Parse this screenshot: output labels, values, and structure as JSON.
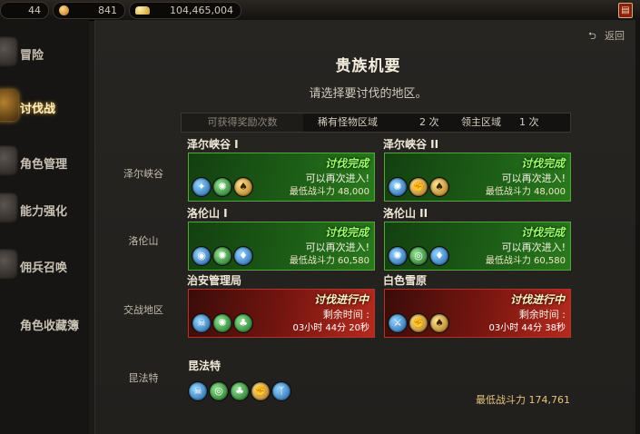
{
  "topbar": {
    "level": "44",
    "coins": "841",
    "gold": "104,465,004"
  },
  "sidebar": {
    "items": [
      {
        "label": "冒险"
      },
      {
        "label": "讨伐战"
      },
      {
        "label": "角色管理"
      },
      {
        "label": "能力强化"
      },
      {
        "label": "佣兵召唤"
      },
      {
        "label": "角色收藏簿"
      }
    ]
  },
  "header": {
    "back": "返回",
    "title": "贵族机要",
    "subtitle": "请选择要讨伐的地区。"
  },
  "rewards": {
    "label": "可获得奖励次数",
    "rare_label": "稀有怪物区域",
    "rare_count": "2 次",
    "boss_label": "领主区域",
    "boss_count": "1 次"
  },
  "regions": [
    {
      "name": "泽尔峡谷",
      "cards": [
        {
          "name": "泽尔峡谷 I",
          "status": "讨伐完成",
          "line1": "可以再次进入!",
          "line2": "最低战斗力 48,000",
          "state": "done",
          "icons": [
            "blue",
            "green",
            "gold"
          ]
        },
        {
          "name": "泽尔峡谷 II",
          "status": "讨伐完成",
          "line1": "可以再次进入!",
          "line2": "最低战斗力 48,000",
          "state": "done",
          "icons": [
            "blue",
            "gold",
            "gold"
          ]
        }
      ]
    },
    {
      "name": "洛伦山",
      "cards": [
        {
          "name": "洛伦山 I",
          "status": "讨伐完成",
          "line1": "可以再次进入!",
          "line2": "最低战斗力 60,580",
          "state": "done",
          "icons": [
            "blue",
            "green",
            "blue"
          ]
        },
        {
          "name": "洛伦山 II",
          "status": "讨伐完成",
          "line1": "可以再次进入!",
          "line2": "最低战斗力 60,580",
          "state": "done",
          "icons": [
            "blue",
            "green",
            "blue"
          ]
        }
      ]
    },
    {
      "name": "交战地区",
      "cards": [
        {
          "name": "治安管理局",
          "status": "讨伐进行中",
          "line1": "剩余时间 :",
          "line2": "03小时 44分 20秒",
          "state": "progress",
          "icons": [
            "blue",
            "green",
            "green"
          ]
        },
        {
          "name": "白色雪原",
          "status": "讨伐进行中",
          "line1": "剩余时间 :",
          "line2": "03小时 44分 38秒",
          "state": "progress",
          "icons": [
            "blue",
            "gold",
            "gold"
          ]
        }
      ]
    }
  ],
  "boss": {
    "region": "昆法特",
    "name": "昆法特",
    "power": "最低战斗力 174,761",
    "icons": [
      "blue",
      "green",
      "green",
      "gold",
      "blue"
    ]
  }
}
